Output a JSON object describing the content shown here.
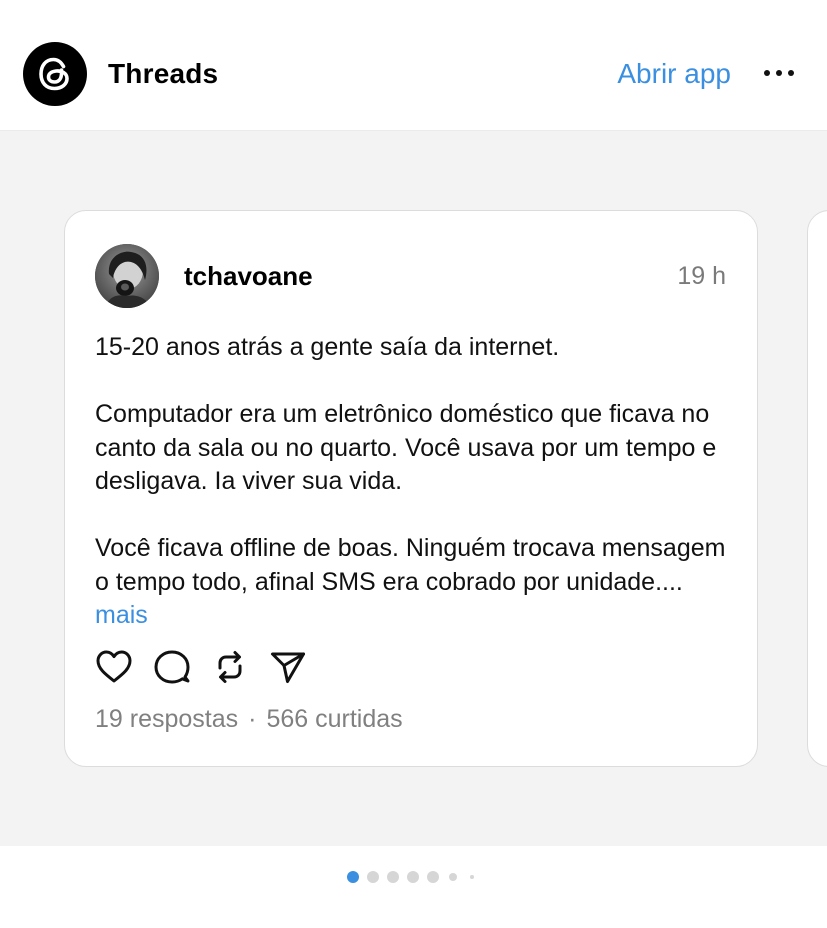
{
  "header": {
    "app_name": "Threads",
    "open_app_label": "Abrir app",
    "logo_icon": "threads-logo-icon",
    "menu_icon": "more-dots-icon"
  },
  "post": {
    "username": "tchavoane",
    "time": "19 h",
    "paragraphs": [
      "15-20 anos atrás a gente saía da internet.",
      "Computador era um eletrônico doméstico que ficava no canto da sala ou no quarto. Você usava por um tempo e desligava. Ia viver sua vida.",
      "Você ficava offline de boas. Ninguém trocava mensagem o tempo todo, afinal SMS era cobrado por unidade...."
    ],
    "more_label": "mais",
    "actions": [
      "heart-icon",
      "comment-icon",
      "repost-icon",
      "share-icon"
    ],
    "replies": "19 respostas",
    "separator": "·",
    "likes": "566 curtidas"
  },
  "pagination": {
    "total_dots": 7,
    "active_index": 0
  },
  "colors": {
    "accent": "#3b8fe0",
    "background": "#f3f3f3",
    "muted_text": "#808080"
  }
}
